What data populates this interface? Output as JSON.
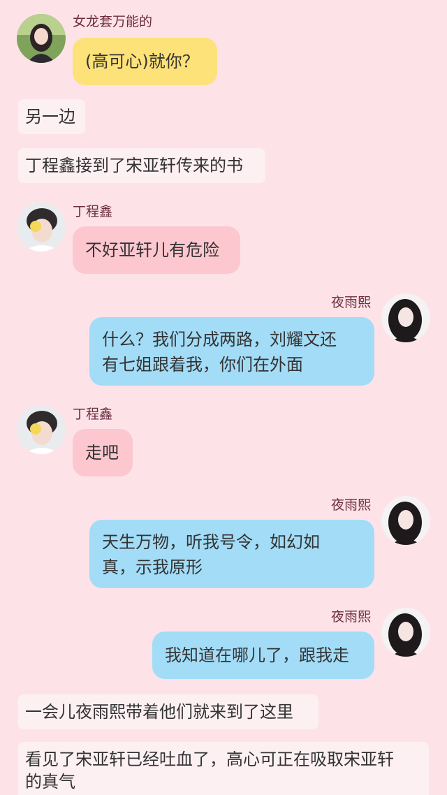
{
  "messages": [
    {
      "speaker": "女龙套万能的",
      "text": "(高可心)就你？"
    },
    {
      "narration": "另一边"
    },
    {
      "narration": "丁程鑫接到了宋亚轩传来的书"
    },
    {
      "speaker": "丁程鑫",
      "text": "不好亚轩儿有危险"
    },
    {
      "speaker": "夜雨熙",
      "text_line1": "什么？我们分成两路，刘耀文还",
      "text_line2": "有七姐跟着我，你们在外面"
    },
    {
      "speaker": "丁程鑫",
      "text": "走吧"
    },
    {
      "speaker": "夜雨熙",
      "text_line1": "天生万物，听我号令，如幻如",
      "text_line2": "真，示我原形"
    },
    {
      "speaker": "夜雨熙",
      "text": "我知道在哪儿了，跟我走"
    },
    {
      "narration": "一会儿夜雨熙带着他们就来到了这里"
    },
    {
      "narration_line1": "看见了宋亚轩已经吐血了，高心可正在吸取宋亚轩",
      "narration_line2": "的真气"
    }
  ],
  "colors": {
    "background": "#fde3e8",
    "bubble_yellow": "#fde179",
    "bubble_pink": "#fcc7cf",
    "bubble_blue": "#a3dcf7",
    "narration_bg": "#fdf0f3",
    "name_text": "#6b2b40"
  }
}
